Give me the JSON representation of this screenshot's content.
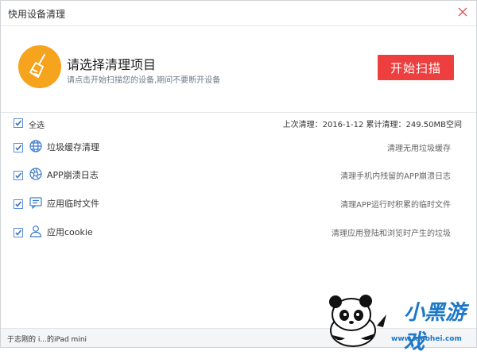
{
  "window": {
    "title": "快用设备清理"
  },
  "header": {
    "title": "请选择清理项目",
    "subtitle": "请点击开始扫描您的设备,期间不要断开设备",
    "start_button": "开始扫描"
  },
  "select_all": {
    "label": "全选",
    "checked": true,
    "last_clean": "上次清理：2016-1-12  累计清理：249.50MB空间"
  },
  "items": [
    {
      "label": "垃圾缓存清理",
      "desc": "清理无用垃圾缓存",
      "icon": "globe-icon",
      "checked": true
    },
    {
      "label": "APP崩溃日志",
      "desc": "清理手机内残留的APP崩溃日志",
      "icon": "aperture-icon",
      "checked": true
    },
    {
      "label": "应用临时文件",
      "desc": "清理APP运行时积累的临时文件",
      "icon": "chat-window-icon",
      "checked": true
    },
    {
      "label": "应用cookie",
      "desc": "清理应用登陆和浏览时产生的垃圾",
      "icon": "user-icon",
      "checked": true
    }
  ],
  "status": {
    "device": "于志刚的 i...的iPad mini"
  },
  "watermark": {
    "text": "小黑游戏",
    "url": "www.xiaohei.com"
  },
  "colors": {
    "accent": "#ee3f3f",
    "logo": "#f6a31d",
    "check": "#5b8fd6",
    "watermark": "#1e78c8"
  }
}
